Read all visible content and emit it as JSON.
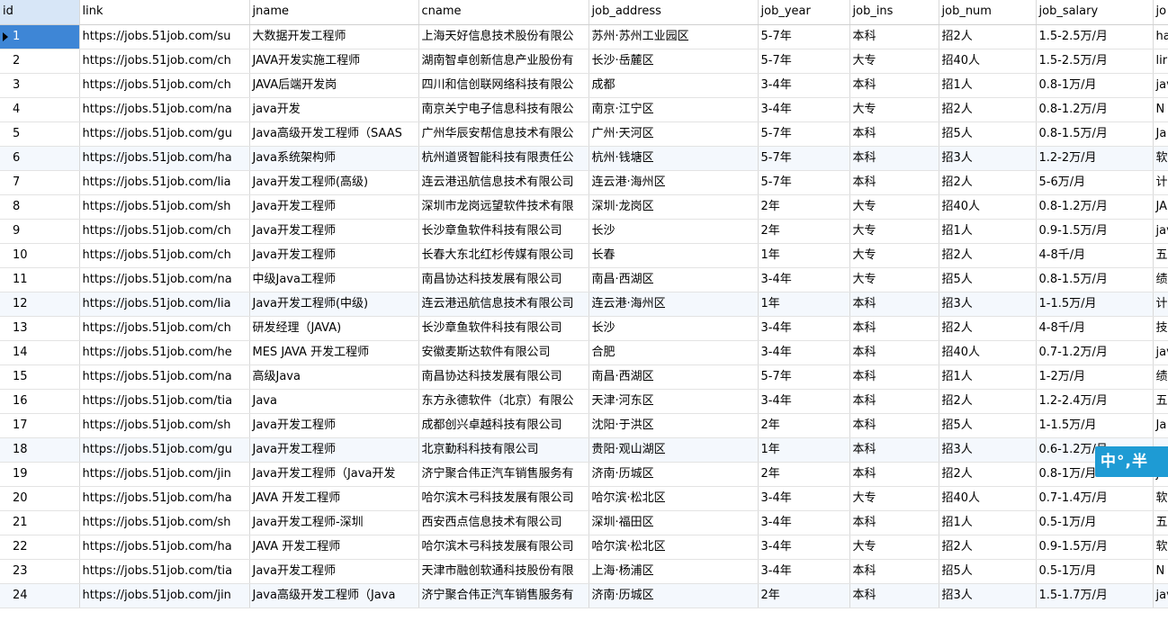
{
  "columns": [
    "id",
    "link",
    "jname",
    "cname",
    "job_address",
    "job_year",
    "job_ins",
    "job_num",
    "job_salary",
    "jo"
  ],
  "rows": [
    [
      "1",
      "https://jobs.51job.com/su",
      "大数据开发工程师",
      "上海天好信息技术股份有限公",
      "苏州·苏州工业园区",
      "5-7年",
      "本科",
      "招2人",
      "1.5-2.5万/月",
      "ha"
    ],
    [
      "2",
      "https://jobs.51job.com/ch",
      "JAVA开发实施工程师",
      "湖南智卓创新信息产业股份有",
      "长沙·岳麓区",
      "5-7年",
      "大专",
      "招40人",
      "1.5-2.5万/月",
      "lir"
    ],
    [
      "3",
      "https://jobs.51job.com/ch",
      "JAVA后端开发岗",
      "四川和信创联网络科技有限公",
      "成都",
      "3-4年",
      "本科",
      "招1人",
      "0.8-1万/月",
      "jav"
    ],
    [
      "4",
      "https://jobs.51job.com/na",
      "java开发",
      "南京关宁电子信息科技有限公",
      "南京·江宁区",
      "3-4年",
      "大专",
      "招2人",
      "0.8-1.2万/月",
      "N"
    ],
    [
      "5",
      "https://jobs.51job.com/gu",
      "Java高级开发工程师（SAAS",
      "广州华辰安帮信息技术有限公",
      "广州·天河区",
      "5-7年",
      "本科",
      "招5人",
      "0.8-1.5万/月",
      "Ja"
    ],
    [
      "6",
      "https://jobs.51job.com/ha",
      "Java系统架构师",
      "杭州道贤智能科技有限责任公",
      "杭州·钱塘区",
      "5-7年",
      "本科",
      "招3人",
      "1.2-2万/月",
      "软"
    ],
    [
      "7",
      "https://jobs.51job.com/lia",
      "Java开发工程师(高级)",
      "连云港迅航信息技术有限公司",
      "连云港·海州区",
      "5-7年",
      "本科",
      "招2人",
      "5-6万/月",
      "计"
    ],
    [
      "8",
      "https://jobs.51job.com/sh",
      "Java开发工程师",
      "深圳市龙岗远望软件技术有限",
      "深圳·龙岗区",
      "2年",
      "大专",
      "招40人",
      "0.8-1.2万/月",
      "JA"
    ],
    [
      "9",
      "https://jobs.51job.com/ch",
      "Java开发工程师",
      "长沙章鱼软件科技有限公司",
      "长沙",
      "2年",
      "大专",
      "招1人",
      "0.9-1.5万/月",
      "jav"
    ],
    [
      "10",
      "https://jobs.51job.com/ch",
      "Java开发工程师",
      "长春大东北红杉传媒有限公司",
      "长春",
      "1年",
      "大专",
      "招2人",
      "4-8千/月",
      "五"
    ],
    [
      "11",
      "https://jobs.51job.com/na",
      "中级Java工程师",
      "南昌协达科技发展有限公司",
      "南昌·西湖区",
      "3-4年",
      "大专",
      "招5人",
      "0.8-1.5万/月",
      "绩"
    ],
    [
      "12",
      "https://jobs.51job.com/lia",
      "Java开发工程师(中级)",
      "连云港迅航信息技术有限公司",
      "连云港·海州区",
      "1年",
      "本科",
      "招3人",
      "1-1.5万/月",
      "计"
    ],
    [
      "13",
      "https://jobs.51job.com/ch",
      "研发经理（JAVA)",
      "长沙章鱼软件科技有限公司",
      "长沙",
      "3-4年",
      "本科",
      "招2人",
      "4-8千/月",
      "技"
    ],
    [
      "14",
      "https://jobs.51job.com/he",
      "MES JAVA 开发工程师",
      "安徽麦斯达软件有限公司",
      "合肥",
      "3-4年",
      "本科",
      "招40人",
      "0.7-1.2万/月",
      "jav"
    ],
    [
      "15",
      "https://jobs.51job.com/na",
      "高级Java",
      "南昌协达科技发展有限公司",
      "南昌·西湖区",
      "5-7年",
      "本科",
      "招1人",
      "1-2万/月",
      "绩"
    ],
    [
      "16",
      "https://jobs.51job.com/tia",
      "Java",
      "东方永德软件（北京）有限公",
      "天津·河东区",
      "3-4年",
      "本科",
      "招2人",
      "1.2-2.4万/月",
      "五"
    ],
    [
      "17",
      "https://jobs.51job.com/sh",
      "Java开发工程师",
      "成都创兴卓越科技有限公司",
      "沈阳·于洪区",
      "2年",
      "本科",
      "招5人",
      "1-1.5万/月",
      "Ja"
    ],
    [
      "18",
      "https://jobs.51job.com/gu",
      "Java开发工程师",
      "北京勤科科技有限公司",
      "贵阳·观山湖区",
      "1年",
      "本科",
      "招3人",
      "0.6-1.2万/月",
      ""
    ],
    [
      "19",
      "https://jobs.51job.com/jin",
      "Java开发工程师（Java开发",
      "济宁聚合伟正汽车销售服务有",
      "济南·历城区",
      "2年",
      "本科",
      "招2人",
      "0.8-1万/月",
      "jav"
    ],
    [
      "20",
      "https://jobs.51job.com/ha",
      "JAVA 开发工程师",
      "哈尔滨木弓科技发展有限公司",
      "哈尔滨·松北区",
      "3-4年",
      "大专",
      "招40人",
      "0.7-1.4万/月",
      "软"
    ],
    [
      "21",
      "https://jobs.51job.com/sh",
      "Java开发工程师-深圳",
      "西安西点信息技术有限公司",
      "深圳·福田区",
      "3-4年",
      "本科",
      "招1人",
      "0.5-1万/月",
      "五"
    ],
    [
      "22",
      "https://jobs.51job.com/ha",
      "JAVA 开发工程师",
      "哈尔滨木弓科技发展有限公司",
      "哈尔滨·松北区",
      "3-4年",
      "大专",
      "招2人",
      "0.9-1.5万/月",
      "软"
    ],
    [
      "23",
      "https://jobs.51job.com/tia",
      "Java开发工程师",
      "天津市融创软通科技股份有限",
      "上海·杨浦区",
      "3-4年",
      "本科",
      "招5人",
      "0.5-1万/月",
      "N"
    ],
    [
      "24",
      "https://jobs.51job.com/jin",
      "Java高级开发工程师（Java",
      "济宁聚合伟正汽车销售服务有",
      "济南·历城区",
      "2年",
      "本科",
      "招3人",
      "1.5-1.7万/月",
      "jav"
    ]
  ],
  "ime_indicator": "中°,半"
}
